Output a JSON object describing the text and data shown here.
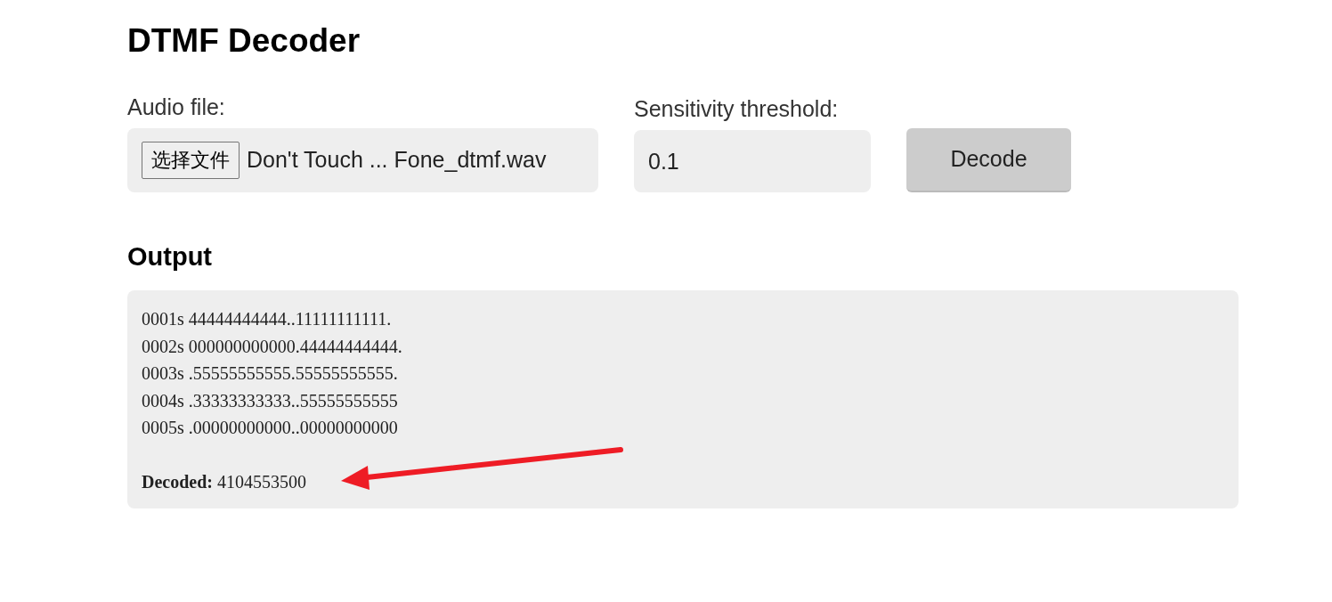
{
  "title": "DTMF Decoder",
  "audio_file": {
    "label": "Audio file:",
    "button": "选择文件",
    "file_name": "Don't Touch ... Fone_dtmf.wav"
  },
  "threshold": {
    "label": "Sensitivity threshold:",
    "value": "0.1"
  },
  "decode_button": "Decode",
  "output": {
    "heading": "Output",
    "lines": [
      "0001s 44444444444..11111111111.",
      "0002s 000000000000.44444444444.",
      "0003s .55555555555.55555555555.",
      "0004s .33333333333..55555555555",
      "0005s .00000000000..00000000000"
    ],
    "result": "**Decoded:** 4104553500"
  }
}
